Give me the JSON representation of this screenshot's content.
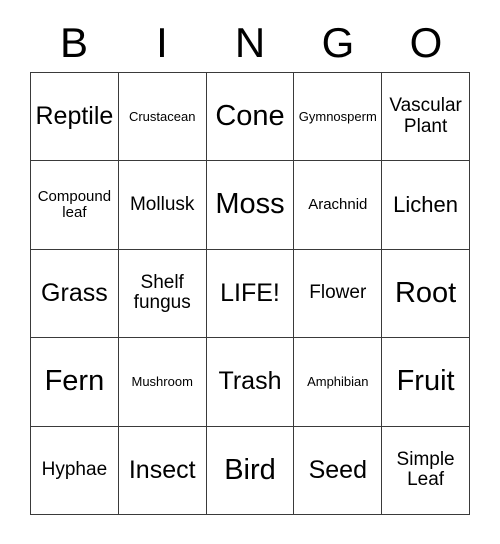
{
  "card": {
    "header_letters": [
      "B",
      "I",
      "N",
      "G",
      "O"
    ],
    "rows": [
      [
        {
          "text": "Reptile",
          "size": "xl"
        },
        {
          "text": "Crustacean",
          "size": "xs"
        },
        {
          "text": "Cone",
          "size": "2xl"
        },
        {
          "text": "Gymnosperm",
          "size": "xs"
        },
        {
          "text": "Vascular\nPlant",
          "size": "md"
        }
      ],
      [
        {
          "text": "Compound\nleaf",
          "size": "sm"
        },
        {
          "text": "Mollusk",
          "size": "md"
        },
        {
          "text": "Moss",
          "size": "2xl"
        },
        {
          "text": "Arachnid",
          "size": "sm"
        },
        {
          "text": "Lichen",
          "size": "lg"
        }
      ],
      [
        {
          "text": "Grass",
          "size": "xl"
        },
        {
          "text": "Shelf\nfungus",
          "size": "md"
        },
        {
          "text": "LIFE!",
          "size": "xl"
        },
        {
          "text": "Flower",
          "size": "md"
        },
        {
          "text": "Root",
          "size": "2xl"
        }
      ],
      [
        {
          "text": "Fern",
          "size": "2xl"
        },
        {
          "text": "Mushroom",
          "size": "xs"
        },
        {
          "text": "Trash",
          "size": "xl"
        },
        {
          "text": "Amphibian",
          "size": "xs"
        },
        {
          "text": "Fruit",
          "size": "2xl"
        }
      ],
      [
        {
          "text": "Hyphae",
          "size": "md"
        },
        {
          "text": "Insect",
          "size": "xl"
        },
        {
          "text": "Bird",
          "size": "2xl"
        },
        {
          "text": "Seed",
          "size": "xl"
        },
        {
          "text": "Simple\nLeaf",
          "size": "md"
        }
      ]
    ],
    "colors": {
      "background": "#ffffff",
      "text": "#000000",
      "grid_line": "#3a3a3a"
    }
  }
}
